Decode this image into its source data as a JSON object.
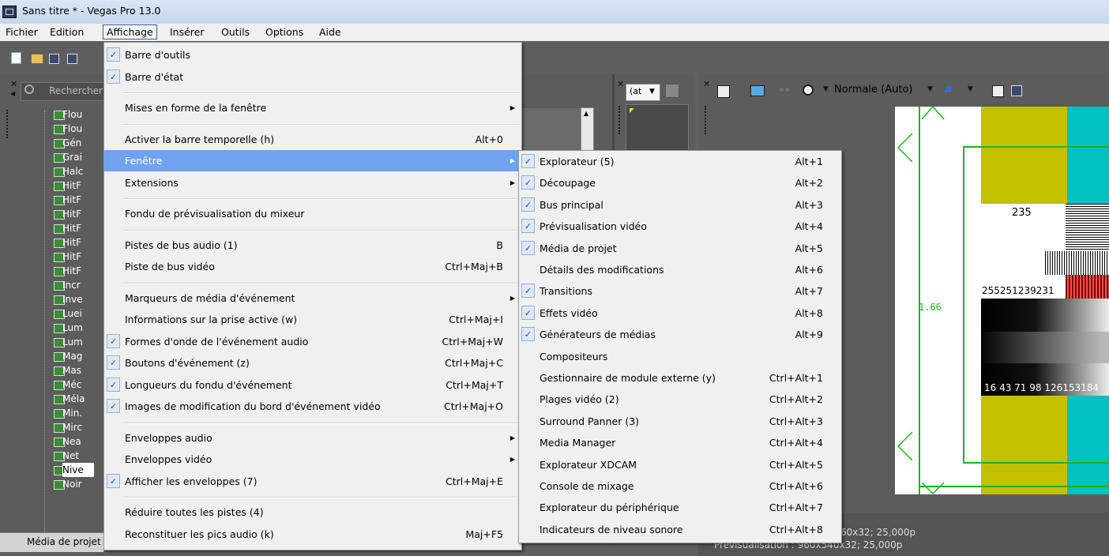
{
  "window": {
    "title": "Sans titre * - Vegas Pro 13.0"
  },
  "menubar": {
    "items": [
      "Fichier",
      "Edition",
      "Affichage",
      "Insérer",
      "Outils",
      "Options",
      "Aide"
    ]
  },
  "left_panel": {
    "search_placeholder": "Rechercher",
    "tree_items": [
      "Flou",
      "Flou",
      "Gén",
      "Grai",
      "Halc",
      "HitF",
      "HitF",
      "HitF",
      "HitF",
      "HitF",
      "HitF",
      "HitF",
      "Incr",
      "Inve",
      "Luei",
      "Lum",
      "Lum",
      "Mag",
      "Mas",
      "Méc",
      "Méla",
      "Min.",
      "Mirc",
      "Nea",
      "Net",
      "Nive",
      "Noir"
    ],
    "tab_label": "Média de projet"
  },
  "middle_panel": {
    "combo_value": "(at"
  },
  "preview_toolbar": {
    "quality_label": "Normale (Auto)"
  },
  "preview": {
    "number_235": "235",
    "value_166": "1.66",
    "row_values_1": "255251239231",
    "row_values_2": "16 43 71 98 126153184",
    "status_1": "Prévisualisation : 960x540x32; 25,000p",
    "status_1_partial": "60x32; 25,000p"
  },
  "affichage_menu": [
    {
      "label": "Barre d'outils",
      "ul": "o",
      "checked": true,
      "sc": "",
      "arrow": false
    },
    {
      "label": "Barre d'état",
      "ul": "a",
      "checked": true,
      "sc": "",
      "arrow": false
    },
    {
      "sep": true
    },
    {
      "label": "Mises en forme de la fenêtre",
      "checked": false,
      "sc": "",
      "arrow": true
    },
    {
      "sep": true
    },
    {
      "label": "Activer la barre temporelle (h)",
      "checked": false,
      "sc": "Alt+0",
      "arrow": false
    },
    {
      "label": "Fenêtre",
      "checked": false,
      "sc": "",
      "arrow": true,
      "highlight": true
    },
    {
      "label": "Extensions",
      "checked": false,
      "sc": "",
      "arrow": true
    },
    {
      "sep": true
    },
    {
      "label": "Fondu de prévisualisation du mixeur",
      "checked": false,
      "sc": "",
      "arrow": false
    },
    {
      "sep": true
    },
    {
      "label": "Pistes de bus audio (1)",
      "checked": false,
      "sc": "B",
      "arrow": false
    },
    {
      "label": "Piste de bus vidéo",
      "checked": false,
      "sc": "Ctrl+Maj+B",
      "arrow": false
    },
    {
      "sep": true
    },
    {
      "label": "Marqueurs de média d'événement",
      "checked": false,
      "sc": "",
      "arrow": true
    },
    {
      "label": "Informations sur la prise active (w)",
      "checked": false,
      "sc": "Ctrl+Maj+I",
      "arrow": false
    },
    {
      "label": "Formes d'onde de l'événement audio",
      "checked": true,
      "sc": "Ctrl+Maj+W",
      "arrow": false
    },
    {
      "label": "Boutons d'événement (z)",
      "checked": true,
      "sc": "Ctrl+Maj+C",
      "arrow": false
    },
    {
      "label": "Longueurs du fondu d'événement",
      "checked": true,
      "sc": "Ctrl+Maj+T",
      "arrow": false
    },
    {
      "label": "Images de modification du bord d'événement vidéo",
      "checked": true,
      "sc": "Ctrl+Maj+O",
      "arrow": false
    },
    {
      "sep": true
    },
    {
      "label": "Enveloppes audio",
      "checked": false,
      "sc": "",
      "arrow": true
    },
    {
      "label": "Enveloppes vidéo",
      "checked": false,
      "sc": "",
      "arrow": true
    },
    {
      "label": "Afficher les enveloppes (7)",
      "checked": true,
      "sc": "Ctrl+Maj+E",
      "arrow": false
    },
    {
      "sep": true
    },
    {
      "label": "Réduire toutes les pistes (4)",
      "checked": false,
      "sc": "",
      "arrow": false
    },
    {
      "label": "Reconstituer les pics audio (k)",
      "checked": false,
      "sc": "Maj+F5",
      "arrow": false
    }
  ],
  "fenetre_submenu": [
    {
      "label": "Explorateur (5)",
      "checked": true,
      "sc": "Alt+1"
    },
    {
      "label": "Découpage",
      "checked": true,
      "sc": "Alt+2"
    },
    {
      "label": "Bus principal",
      "checked": true,
      "sc": "Alt+3"
    },
    {
      "label": "Prévisualisation vidéo",
      "checked": true,
      "sc": "Alt+4"
    },
    {
      "label": "Média de projet",
      "checked": true,
      "sc": "Alt+5"
    },
    {
      "label": "Détails des modifications",
      "checked": false,
      "sc": "Alt+6"
    },
    {
      "label": "Transitions",
      "checked": true,
      "sc": "Alt+7"
    },
    {
      "label": "Effets vidéo",
      "checked": true,
      "sc": "Alt+8"
    },
    {
      "label": "Générateurs de médias",
      "checked": true,
      "sc": "Alt+9"
    },
    {
      "label": "Compositeurs",
      "checked": false,
      "sc": ""
    },
    {
      "label": "Gestionnaire de module externe (y)",
      "checked": false,
      "sc": "Ctrl+Alt+1"
    },
    {
      "label": "Plages vidéo (2)",
      "checked": false,
      "sc": "Ctrl+Alt+2"
    },
    {
      "label": "Surround Panner (3)",
      "checked": false,
      "sc": "Ctrl+Alt+3"
    },
    {
      "label": "Media Manager",
      "checked": false,
      "sc": "Ctrl+Alt+4"
    },
    {
      "label": "Explorateur XDCAM",
      "checked": false,
      "sc": "Ctrl+Alt+5"
    },
    {
      "label": "Console de mixage",
      "checked": false,
      "sc": "Ctrl+Alt+6"
    },
    {
      "label": "Explorateur du périphérique",
      "checked": false,
      "sc": "Ctrl+Alt+7"
    },
    {
      "label": "Indicateurs de niveau sonore",
      "checked": false,
      "sc": "Ctrl+Alt+8"
    }
  ],
  "colors": {
    "highlight": "#6fa2ef",
    "panel": "#5c5c5c",
    "menu_bg": "#f0f0f0",
    "bars_yellow": "#c3c000",
    "bars_cyan": "#00c0c0",
    "safe_area": "#1db31d"
  }
}
